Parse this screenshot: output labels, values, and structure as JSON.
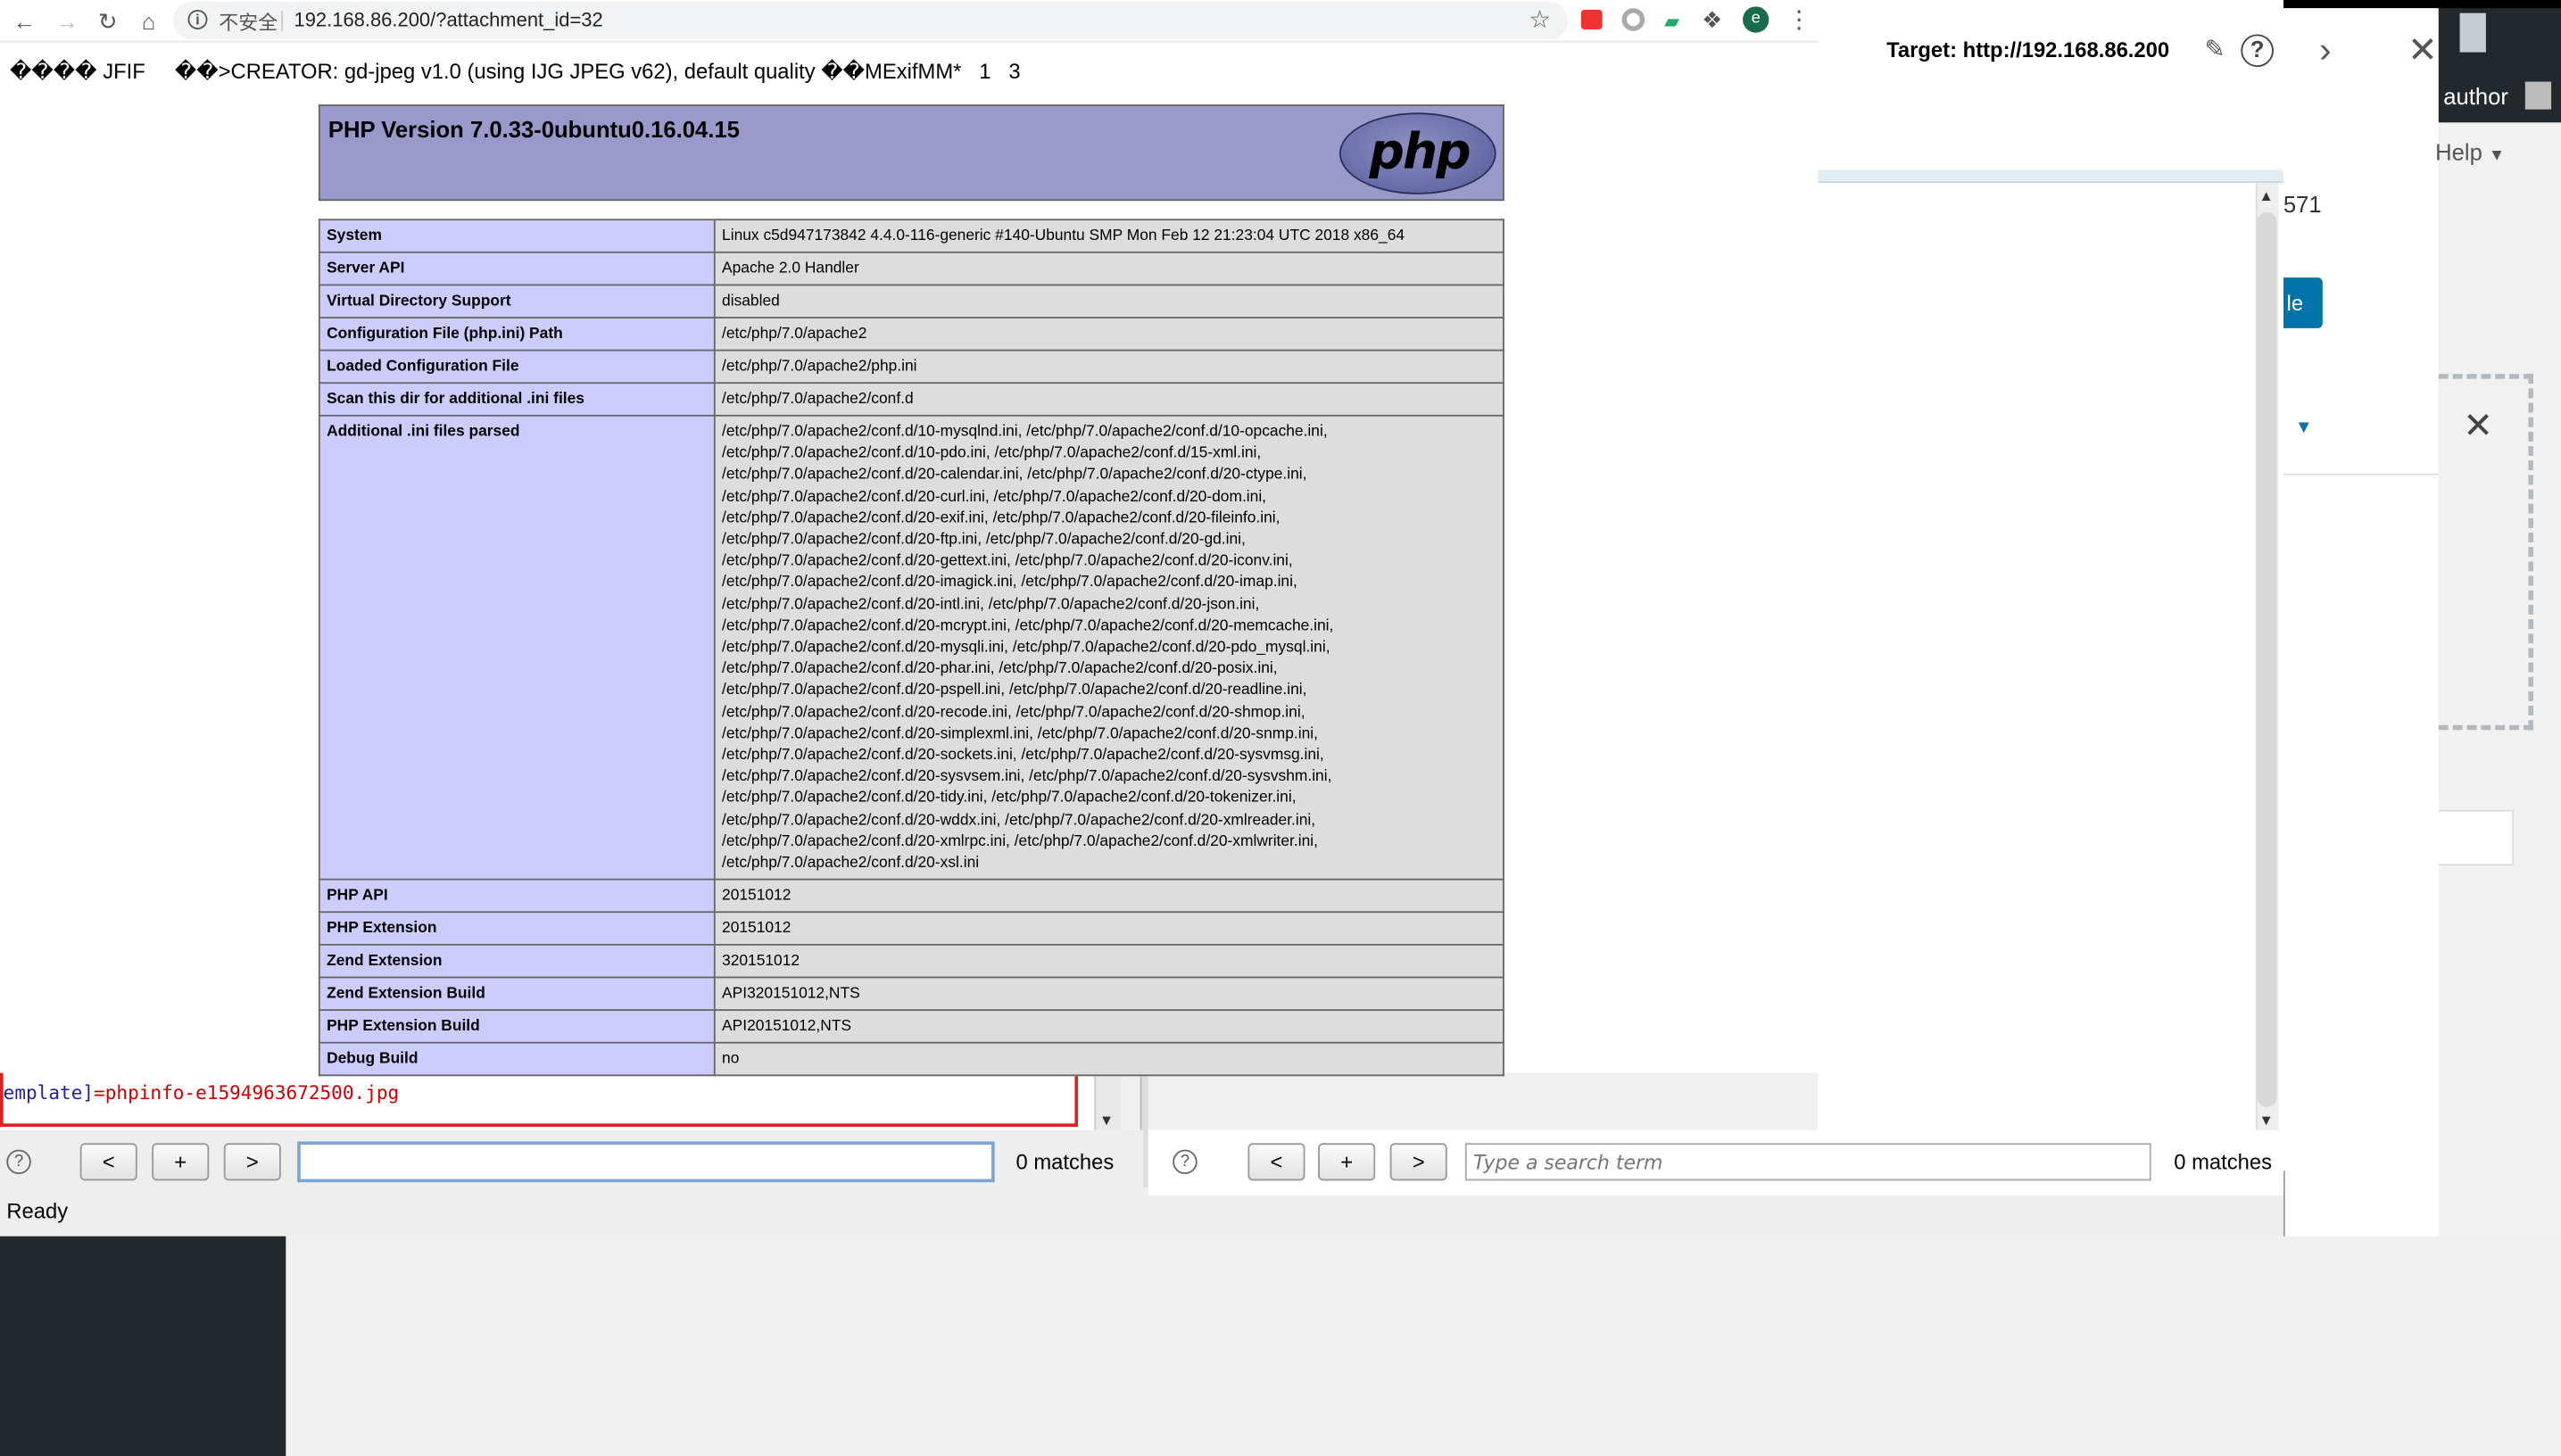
{
  "browser": {
    "insecure_label": "不安全",
    "url": "192.168.86.200/?attachment_id=32",
    "profile_initial": "e"
  },
  "page": {
    "jfif_line": "���� JFIF     ��>CREATOR: gd-jpeg v1.0 (using IJG JPEG v62), default quality ��MExifMM*   1   3",
    "php_title": "PHP Version 7.0.33-0ubuntu0.16.04.15",
    "php_logo_text": "php",
    "rows": [
      {
        "key": "System",
        "value": "Linux c5d947173842 4.4.0-116-generic #140-Ubuntu SMP Mon Feb 12 21:23:04 UTC 2018 x86_64"
      },
      {
        "key": "Server API",
        "value": "Apache 2.0 Handler"
      },
      {
        "key": "Virtual Directory Support",
        "value": "disabled"
      },
      {
        "key": "Configuration File (php.ini) Path",
        "value": "/etc/php/7.0/apache2"
      },
      {
        "key": "Loaded Configuration File",
        "value": "/etc/php/7.0/apache2/php.ini"
      },
      {
        "key": "Scan this dir for additional .ini files",
        "value": "/etc/php/7.0/apache2/conf.d"
      },
      {
        "key": "Additional .ini files parsed",
        "value": "/etc/php/7.0/apache2/conf.d/10-mysqlnd.ini, /etc/php/7.0/apache2/conf.d/10-opcache.ini,\n/etc/php/7.0/apache2/conf.d/10-pdo.ini, /etc/php/7.0/apache2/conf.d/15-xml.ini,\n/etc/php/7.0/apache2/conf.d/20-calendar.ini, /etc/php/7.0/apache2/conf.d/20-ctype.ini,\n/etc/php/7.0/apache2/conf.d/20-curl.ini, /etc/php/7.0/apache2/conf.d/20-dom.ini,\n/etc/php/7.0/apache2/conf.d/20-exif.ini, /etc/php/7.0/apache2/conf.d/20-fileinfo.ini,\n/etc/php/7.0/apache2/conf.d/20-ftp.ini, /etc/php/7.0/apache2/conf.d/20-gd.ini,\n/etc/php/7.0/apache2/conf.d/20-gettext.ini, /etc/php/7.0/apache2/conf.d/20-iconv.ini,\n/etc/php/7.0/apache2/conf.d/20-imagick.ini, /etc/php/7.0/apache2/conf.d/20-imap.ini,\n/etc/php/7.0/apache2/conf.d/20-intl.ini, /etc/php/7.0/apache2/conf.d/20-json.ini,\n/etc/php/7.0/apache2/conf.d/20-mcrypt.ini, /etc/php/7.0/apache2/conf.d/20-memcache.ini,\n/etc/php/7.0/apache2/conf.d/20-mysqli.ini, /etc/php/7.0/apache2/conf.d/20-pdo_mysql.ini,\n/etc/php/7.0/apache2/conf.d/20-phar.ini, /etc/php/7.0/apache2/conf.d/20-posix.ini,\n/etc/php/7.0/apache2/conf.d/20-pspell.ini, /etc/php/7.0/apache2/conf.d/20-readline.ini,\n/etc/php/7.0/apache2/conf.d/20-recode.ini, /etc/php/7.0/apache2/conf.d/20-shmop.ini,\n/etc/php/7.0/apache2/conf.d/20-simplexml.ini, /etc/php/7.0/apache2/conf.d/20-snmp.ini,\n/etc/php/7.0/apache2/conf.d/20-sockets.ini, /etc/php/7.0/apache2/conf.d/20-sysvmsg.ini,\n/etc/php/7.0/apache2/conf.d/20-sysvsem.ini, /etc/php/7.0/apache2/conf.d/20-sysvshm.ini,\n/etc/php/7.0/apache2/conf.d/20-tidy.ini, /etc/php/7.0/apache2/conf.d/20-tokenizer.ini,\n/etc/php/7.0/apache2/conf.d/20-wddx.ini, /etc/php/7.0/apache2/conf.d/20-xmlreader.ini,\n/etc/php/7.0/apache2/conf.d/20-xmlrpc.ini, /etc/php/7.0/apache2/conf.d/20-xmlwriter.ini,\n/etc/php/7.0/apache2/conf.d/20-xsl.ini",
        "multi": true
      },
      {
        "key": "PHP API",
        "value": "20151012"
      },
      {
        "key": "PHP Extension",
        "value": "20151012"
      },
      {
        "key": "Zend Extension",
        "value": "320151012"
      },
      {
        "key": "Zend Extension Build",
        "value": "API320151012,NTS"
      },
      {
        "key": "PHP Extension Build",
        "value": "API20151012,NTS"
      },
      {
        "key": "Debug Build",
        "value": "no"
      }
    ]
  },
  "burp": {
    "target_label": "Target:",
    "target_url": "http://192.168.86.200",
    "help_glyph": "?",
    "request_prefix": "emplate]",
    "request_value": "=phpinfo-e1594963672500.jpg",
    "left_search": {
      "help": "?",
      "prev": "<",
      "add": "+",
      "next": ">",
      "value": "",
      "matches": "0 matches"
    },
    "right_search": {
      "help": "?",
      "prev": "<",
      "add": "+",
      "next": ">",
      "placeholder": "Type a search term",
      "matches": "0 matches"
    },
    "status": "Ready"
  },
  "wordpress": {
    "author": "author",
    "help": "Help",
    "number_fragment": "571",
    "button_fragment": "le"
  },
  "colors": {
    "php_header": "#9999cc",
    "php_key_cell": "#ccccff",
    "php_value_cell": "#dddddd",
    "wp_adminbar": "#23282d",
    "wp_button": "#0073aa",
    "request_border": "#e02020"
  }
}
